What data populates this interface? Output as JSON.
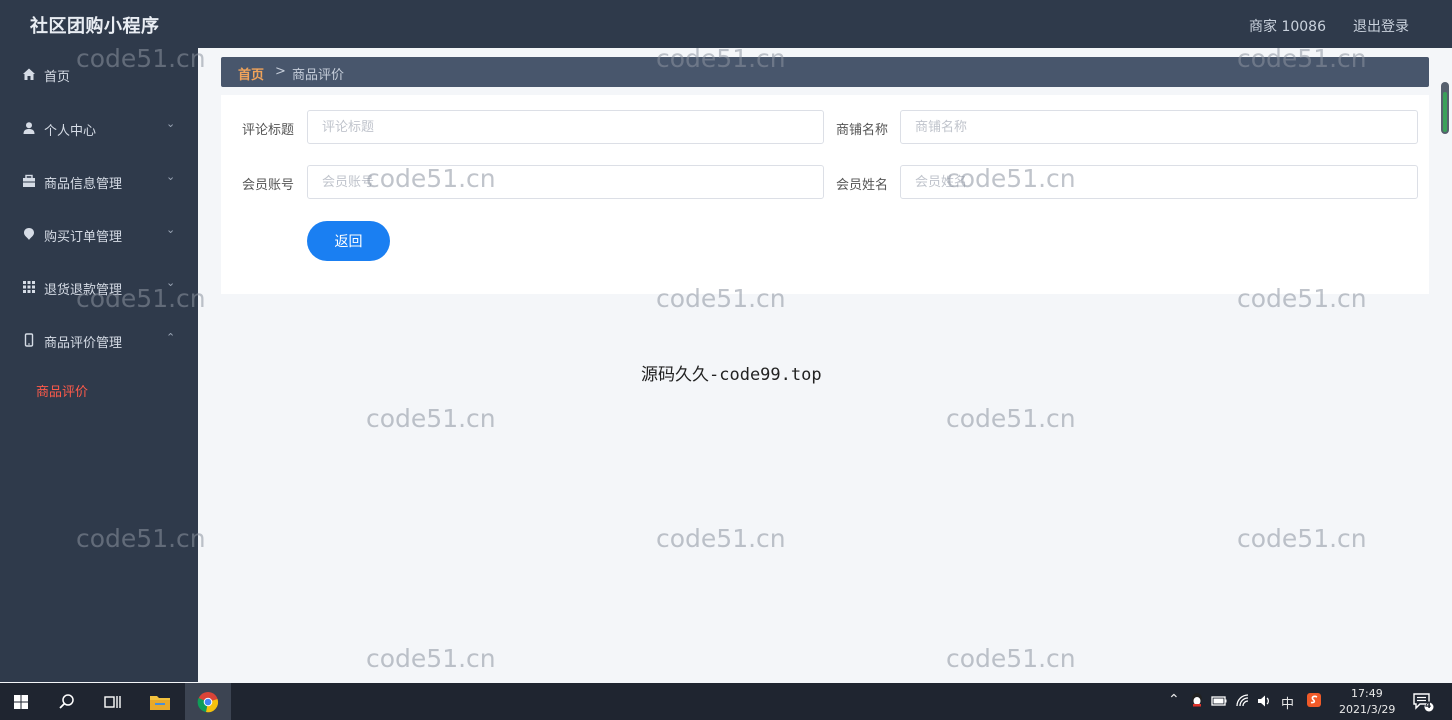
{
  "header": {
    "app_title": "社区团购小程序",
    "merchant": "商家 10086",
    "logout": "退出登录"
  },
  "sidebar": {
    "items": [
      {
        "label": "首页",
        "icon": "home-icon"
      },
      {
        "label": "个人中心",
        "icon": "user-icon"
      },
      {
        "label": "商品信息管理",
        "icon": "box-icon"
      },
      {
        "label": "购买订单管理",
        "icon": "pin-icon"
      },
      {
        "label": "退货退款管理",
        "icon": "grid-icon"
      },
      {
        "label": "商品评价管理",
        "icon": "phone-icon"
      }
    ],
    "sub_active": "商品评价"
  },
  "breadcrumb": {
    "home": "首页",
    "sep": ">",
    "current": "商品评价"
  },
  "form": {
    "title_label": "评论标题",
    "title_placeholder": "评论标题",
    "shop_label": "商铺名称",
    "shop_placeholder": "商铺名称",
    "account_label": "会员账号",
    "account_placeholder": "会员账号",
    "name_label": "会员姓名",
    "name_placeholder": "会员姓名",
    "back_button": "返回"
  },
  "footer_note": "源码久久-code99.top",
  "watermark": "code51.cn",
  "taskbar": {
    "ime": "中",
    "time": "17:49",
    "date": "2021/3/29",
    "notifications": "4"
  },
  "colors": {
    "sidebar_bg": "#2f3a4b",
    "accent": "#1a7ff2",
    "active_sub": "#ff5a4a",
    "breadcrumb_home": "#f0a35a"
  }
}
